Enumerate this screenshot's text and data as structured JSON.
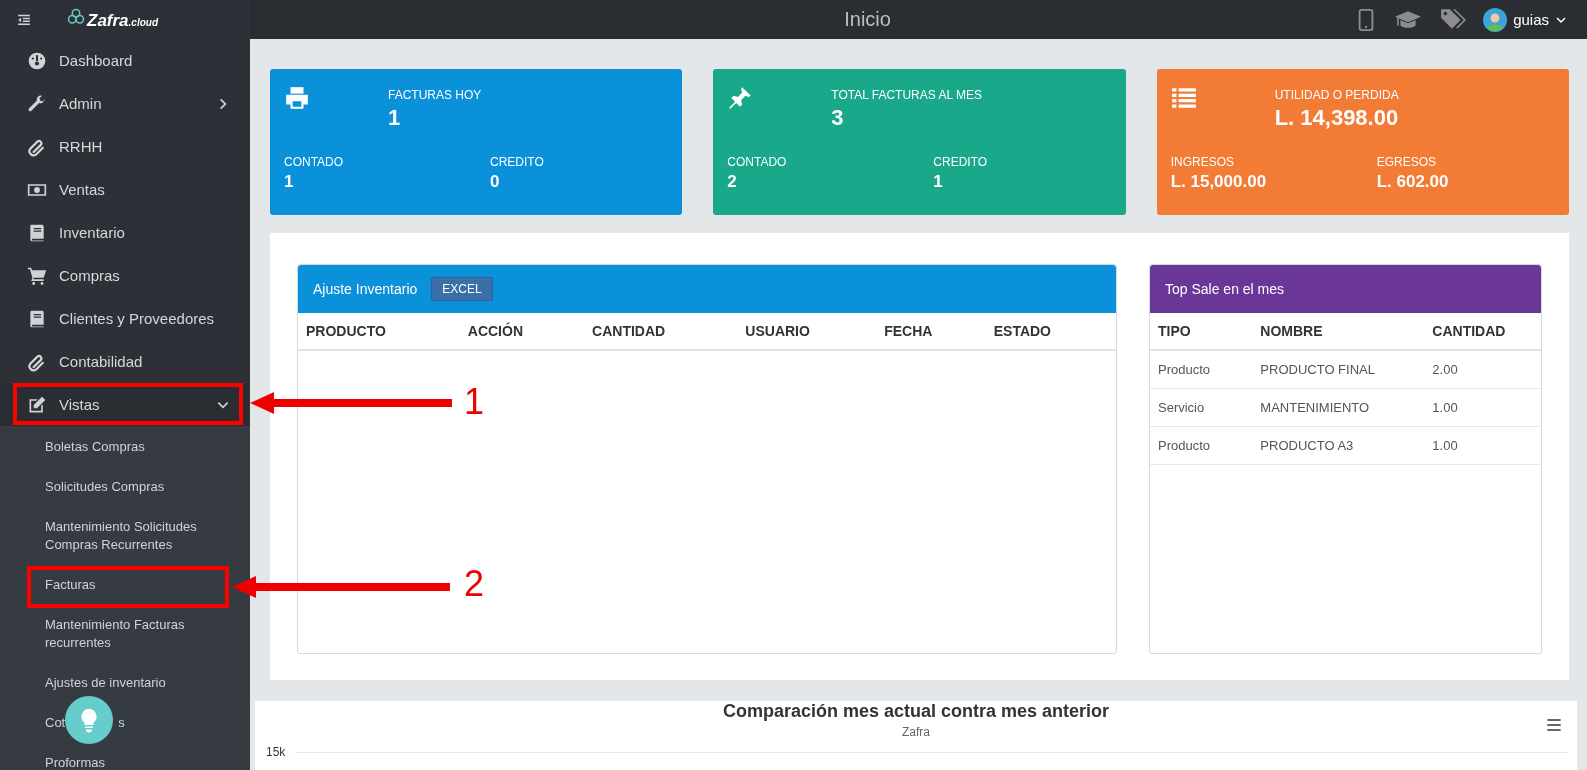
{
  "topbar": {
    "title": "Inicio",
    "user": "guias"
  },
  "logo": {
    "name": "Zafra",
    "suffix": ".cloud"
  },
  "sidebar": {
    "items": [
      {
        "label": "Dashboard"
      },
      {
        "label": "Admin",
        "expanded": false
      },
      {
        "label": "RRHH"
      },
      {
        "label": "Ventas"
      },
      {
        "label": "Inventario"
      },
      {
        "label": "Compras"
      },
      {
        "label": "Clientes y Proveedores"
      },
      {
        "label": "Contabilidad"
      },
      {
        "label": "Vistas",
        "expanded": true,
        "children": [
          {
            "label": "Boletas Compras"
          },
          {
            "label": "Solicitudes Compras"
          },
          {
            "label": "Mantenimiento Solicitudes Compras Recurrentes"
          },
          {
            "label": "Facturas"
          },
          {
            "label": "Mantenimiento Facturas recurrentes"
          },
          {
            "label": "Ajustes de inventario"
          },
          {
            "label": "Cot",
            "label_end": "s"
          },
          {
            "label": "Proformas"
          }
        ]
      }
    ]
  },
  "stat_cards": [
    {
      "color": "#0b90da",
      "title": "FACTURAS HOY",
      "value": "1",
      "parts": [
        {
          "label": "CONTADO",
          "value": "1"
        },
        {
          "label": "CREDITO",
          "value": "0"
        }
      ]
    },
    {
      "color": "#19a88a",
      "title": "TOTAL FACTURAS AL MES",
      "value": "3",
      "parts": [
        {
          "label": "CONTADO",
          "value": "2"
        },
        {
          "label": "CREDITO",
          "value": "1"
        }
      ]
    },
    {
      "color": "#f27b36",
      "title": "UTILIDAD O PERDIDA",
      "value": "L. 14,398.00",
      "parts": [
        {
          "label": "INGRESOS",
          "value": "L. 15,000.00"
        },
        {
          "label": "EGRESOS",
          "value": "L. 602.00"
        }
      ]
    }
  ],
  "panels": [
    {
      "title": "Ajuste Inventario",
      "color": "#0b90da",
      "button": "EXCEL",
      "columns": [
        "PRODUCTO",
        "ACCIÓN",
        "CANTIDAD",
        "USUARIO",
        "FECHA",
        "ESTADO"
      ]
    },
    {
      "title": "Top Sale en el mes",
      "color": "#6a3698",
      "columns": [
        "TIPO",
        "NOMBRE",
        "CANTIDAD"
      ],
      "rows": [
        [
          "Producto",
          "PRODUCTO FINAL",
          "2.00"
        ],
        [
          "Servicio",
          "MANTENIMIENTO",
          "1.00"
        ],
        [
          "Producto",
          "PRODUCTO A3",
          "1.00"
        ]
      ]
    }
  ],
  "chart": {
    "title": "Comparación mes actual contra mes anterior",
    "subtitle": "Zafra",
    "ytick": "15k"
  },
  "annotations": [
    {
      "label": "1"
    },
    {
      "label": "2"
    }
  ]
}
